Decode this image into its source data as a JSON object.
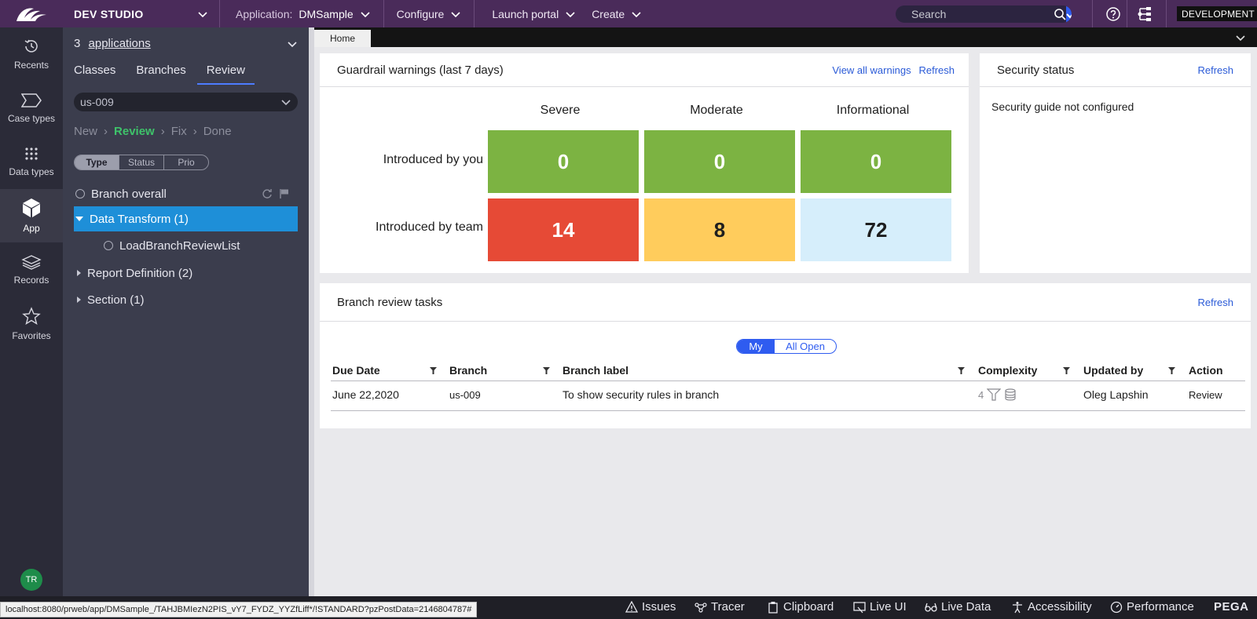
{
  "topbar": {
    "studio": "DEV STUDIO",
    "application_label": "Application:",
    "application_value": "DMSample",
    "menus": [
      "Configure",
      "Launch portal",
      "Create"
    ],
    "search_placeholder": "Search",
    "environment": "DEVELOPMENT"
  },
  "leftnav": {
    "items": [
      {
        "label": "Recents",
        "icon": "history-icon"
      },
      {
        "label": "Case types",
        "icon": "case-types-icon"
      },
      {
        "label": "Data types",
        "icon": "data-types-icon"
      },
      {
        "label": "App",
        "icon": "cube-icon"
      },
      {
        "label": "Records",
        "icon": "layers-icon"
      },
      {
        "label": "Favorites",
        "icon": "star-icon"
      }
    ],
    "active": "App",
    "avatar": "TR"
  },
  "explorer": {
    "apps_count": "3",
    "apps_link": "applications",
    "tabs": [
      "Classes",
      "Branches",
      "Review"
    ],
    "active_tab": "Review",
    "branch_selected": "us-009",
    "stages": [
      "New",
      "Review",
      "Fix",
      "Done"
    ],
    "active_stage": "Review",
    "group_by": [
      "Type",
      "Status",
      "Prio"
    ],
    "active_group": "Type",
    "tree": {
      "branch_overall": "Branch overall",
      "data_transform": "Data Transform (1)",
      "load_branch": "LoadBranchReviewList",
      "report_definition": "Report Definition (2)",
      "section": "Section (1)"
    }
  },
  "tabs": {
    "home": "Home"
  },
  "guardrail": {
    "title": "Guardrail warnings (last 7 days)",
    "view_all": "View all warnings",
    "refresh": "Refresh",
    "columns": [
      "Severe",
      "Moderate",
      "Informational"
    ],
    "rows": [
      {
        "label": "Introduced by you",
        "values": [
          "0",
          "0",
          "0"
        ]
      },
      {
        "label": "Introduced by team",
        "values": [
          "14",
          "8",
          "72"
        ]
      }
    ],
    "colors": {
      "you": [
        "#7cb342",
        "#7cb342",
        "#7cb342"
      ],
      "team": [
        "#e64a36",
        "#ffcc5c",
        "#d6eefb"
      ]
    }
  },
  "security": {
    "title": "Security status",
    "refresh": "Refresh",
    "message": "Security guide not configured"
  },
  "branch_review": {
    "title": "Branch review tasks",
    "refresh": "Refresh",
    "toggle": [
      "My",
      "All Open"
    ],
    "toggle_active": "My",
    "columns": [
      "Due Date",
      "Branch",
      "Branch label",
      "Complexity",
      "Updated by",
      "Action"
    ],
    "rows": [
      {
        "due_date": "June 22,2020",
        "branch": "us-009",
        "label": "To show security rules in branch",
        "complexity": "4",
        "updated_by": "Oleg Lapshin",
        "action": "Review"
      }
    ]
  },
  "statusbar": {
    "url": "localhost:8080/prweb/app/DMSample_/TAHJBMIezN2PIS_vY7_FYDZ_YYZfLiff*/!STANDARD?pzPostData=2146804787#",
    "items": [
      "Issues",
      "Tracer",
      "Clipboard",
      "Live UI",
      "Live Data",
      "Accessibility",
      "Performance"
    ],
    "brand": "PEGA"
  },
  "colors": {
    "header": "#4a2b5a",
    "nav": "#2b2b38",
    "explorer": "#3b3d4d",
    "accent": "#2f5cf0",
    "selected": "#1e8fd8"
  }
}
